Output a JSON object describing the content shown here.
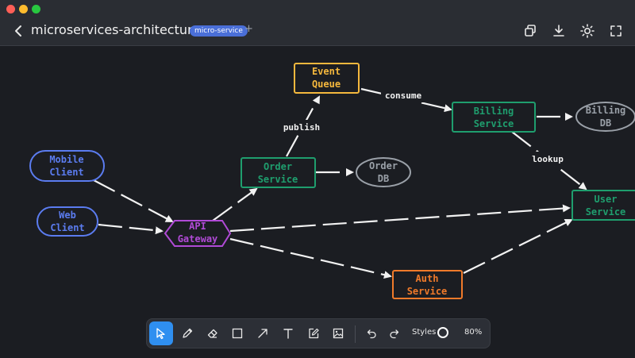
{
  "window": {
    "traffic_lights": {
      "close": "#ff5f57",
      "minimize": "#febc2e",
      "zoom": "#28c840"
    }
  },
  "header": {
    "title": "microservices-architecture",
    "tag": "micro-service",
    "add_symbol": "+",
    "icons": [
      "duplicate-icon",
      "download-icon",
      "theme-sun-icon",
      "fullscreen-icon"
    ]
  },
  "diagram": {
    "nodes": {
      "mobile_client": {
        "line1": "Mobile",
        "line2": "Client",
        "color": "#5b7cf0",
        "shape": "pill"
      },
      "web_client": {
        "line1": "Web",
        "line2": "Client",
        "color": "#5b7cf0",
        "shape": "pill"
      },
      "api_gateway": {
        "line1": "API",
        "line2": "Gateway",
        "color": "#b04ad6",
        "shape": "hexagon"
      },
      "order_service": {
        "line1": "Order",
        "line2": "Service",
        "color": "#1f9e6e",
        "shape": "rect"
      },
      "order_db": {
        "line1": "Order",
        "line2": "DB",
        "color": "#9aa0a8",
        "shape": "ellipse"
      },
      "event_queue": {
        "line1": "Event",
        "line2": "Queue",
        "color": "#f5b83d",
        "shape": "rect"
      },
      "billing_service": {
        "line1": "Billing",
        "line2": "Service",
        "color": "#1f9e6e",
        "shape": "rect"
      },
      "billing_db": {
        "line1": "Billing",
        "line2": "DB",
        "color": "#9aa0a8",
        "shape": "ellipse"
      },
      "user_service": {
        "line1": "User",
        "line2": "Service",
        "color": "#1f9e6e",
        "shape": "rect"
      },
      "auth_service": {
        "line1": "Auth",
        "line2": "Service",
        "color": "#f07a2a",
        "shape": "rect"
      }
    },
    "edge_labels": {
      "publish": "publish",
      "consume": "consume",
      "lookup": "lookup"
    }
  },
  "toolbar": {
    "tools": [
      "select-tool",
      "pencil-tool",
      "eraser-tool",
      "rectangle-tool",
      "arrow-tool",
      "text-tool",
      "edit-note-tool",
      "image-tool"
    ],
    "active_tool": "select-tool",
    "styles_label": "Styles",
    "zoom": "80%",
    "accent": "#2f8ff0"
  }
}
